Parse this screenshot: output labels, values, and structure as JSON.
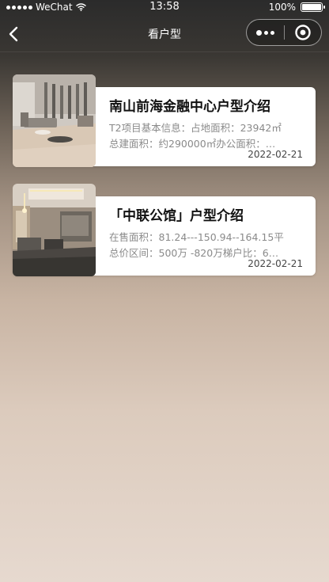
{
  "status_bar": {
    "carrier": "WeChat",
    "time": "13:58",
    "battery": "100%"
  },
  "nav": {
    "title": "看户型"
  },
  "cards": [
    {
      "title": "南山前海金融中心户型介绍",
      "line1": "T2项目基本信息：占地面积：23942㎡",
      "line2": "总建面积：约290000㎡办公面积：…",
      "date": "2022-02-21"
    },
    {
      "title": "「中联公馆」户型介绍",
      "line1": "在售面积：81.24---150.94--164.15平",
      "line2": "总价区间：500万 -820万梯户比：6…",
      "date": "2022-02-21"
    }
  ]
}
